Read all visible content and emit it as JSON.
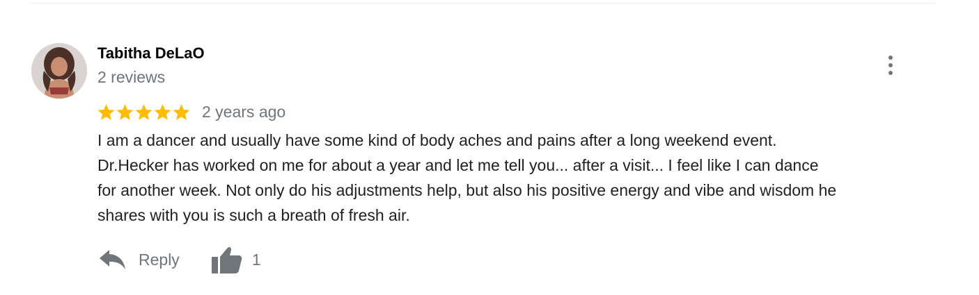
{
  "review": {
    "author_name": "Tabitha DeLaO",
    "review_count": "2 reviews",
    "rating": 5,
    "rating_max": 5,
    "date": "2 years ago",
    "text_lines": [
      "I am a dancer and usually have some kind of body aches and pains after a long weekend event.",
      "Dr.Hecker has worked on me for about a year and let me tell you... after a visit... I feel like I can dance",
      "for another week. Not only do his adjustments help, but also his positive energy and vibe and wisdom he",
      "shares with you is such a breath of fresh air."
    ],
    "more_icon": "more-vert-icon"
  },
  "actions": {
    "reply_label": "Reply",
    "reply_icon": "reply-arrow-icon",
    "like_icon": "thumbs-up-icon",
    "like_count": "1"
  },
  "colors": {
    "star": "#fbbc04",
    "secondary_text": "#70757a",
    "icon": "#70757a",
    "primary_text": "#202124"
  }
}
